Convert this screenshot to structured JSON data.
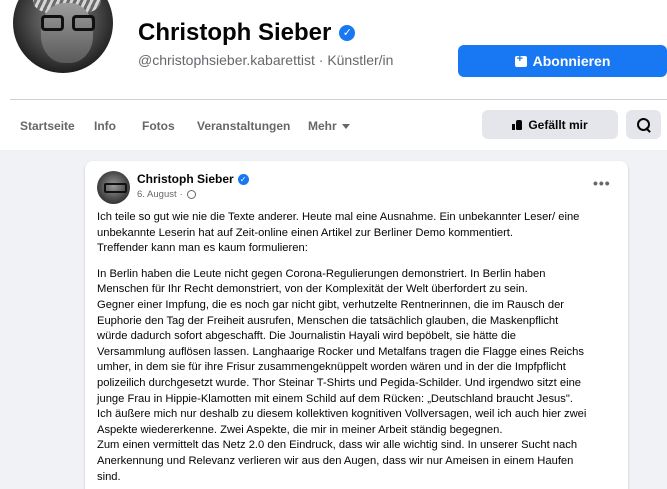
{
  "profile": {
    "name": "Christoph Sieber",
    "handle": "@christophsieber.kabarettist",
    "separator": "·",
    "category": "Künstler/in",
    "verified_glyph": "✓",
    "follow_label": "Abonnieren",
    "follow_icon": "add-page-icon"
  },
  "nav": {
    "tabs": [
      "Startseite",
      "Info",
      "Fotos",
      "Veranstaltungen",
      "Mehr"
    ],
    "like_label": "Gefällt mir",
    "like_icon": "thumbs-up-icon",
    "search_icon": "search-icon"
  },
  "post": {
    "author": "Christoph Sieber",
    "date": "6. August",
    "separator": "·",
    "more_glyph": "•••",
    "intro": [
      "Ich teile so gut wie nie die Texte anderer. Heute mal eine Ausnahme. Ein unbekannter Leser/ eine",
      "unbekannte Leserin hat auf Zeit-online einen Artikel zur Berliner Demo kommentiert.",
      "Treffender kann man es kaum formulieren:"
    ],
    "body": [
      "In Berlin haben die Leute nicht gegen Corona-Regulierungen demonstriert. In Berlin haben",
      "Menschen für Ihr Recht demonstriert, von der Komplexität der Welt überfordert zu sein.",
      "Gegner einer Impfung, die es noch gar nicht gibt, verhutzelte Rentnerinnen, die im Rausch der",
      "Euphorie den Tag der Freiheit ausrufen, Menschen die tatsächlich glauben, die Maskenpflicht",
      "würde dadurch sofort abgeschafft. Die Journalistin Hayali wird bepöbelt, sie hätte die",
      "Versammlung auflösen lassen. Langhaarige Rocker und Metalfans tragen die Flagge eines Reichs",
      "umher, in dem sie für ihre Frisur zusammengeknüppelt worden wären und in der die Impfpflicht",
      "polizeilich durchgesetzt wurde. Thor Steinar T-Shirts und Pegida-Schilder. Und irgendwo sitzt eine",
      "junge Frau in Hippie-Klamotten mit einem Schild auf dem Rücken: „Deutschland braucht Jesus\".",
      "Ich äußere mich nur deshalb zu diesem kollektiven kognitiven Vollversagen, weil ich auch hier zwei",
      "Aspekte wiedererkenne. Zwei Aspekte, die mir in meiner Arbeit ständig begegnen.",
      "Zum einen vermittelt das Netz 2.0 den Eindruck, dass wir alle wichtig sind. In unserer Sucht nach",
      "Anerkennung und Relevanz verlieren wir aus den Augen, dass wir nur Ameisen in einem Haufen",
      "sind."
    ]
  }
}
